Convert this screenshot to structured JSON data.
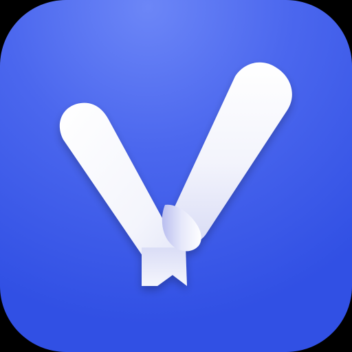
{
  "icon": {
    "kind": "app-icon",
    "glyph": "checkmark-ribbon-icon",
    "colors": {
      "background_outer": "#000000",
      "tile_top": "#6C86F7",
      "tile_mid": "#4B67EE",
      "tile_bottom": "#3150E4",
      "ribbon_light": "#FFFFFF",
      "ribbon_mid": "#EEF0FA",
      "ribbon_shadow": "#C9CDF0",
      "fold_shadow": "#9DA3E6"
    }
  }
}
